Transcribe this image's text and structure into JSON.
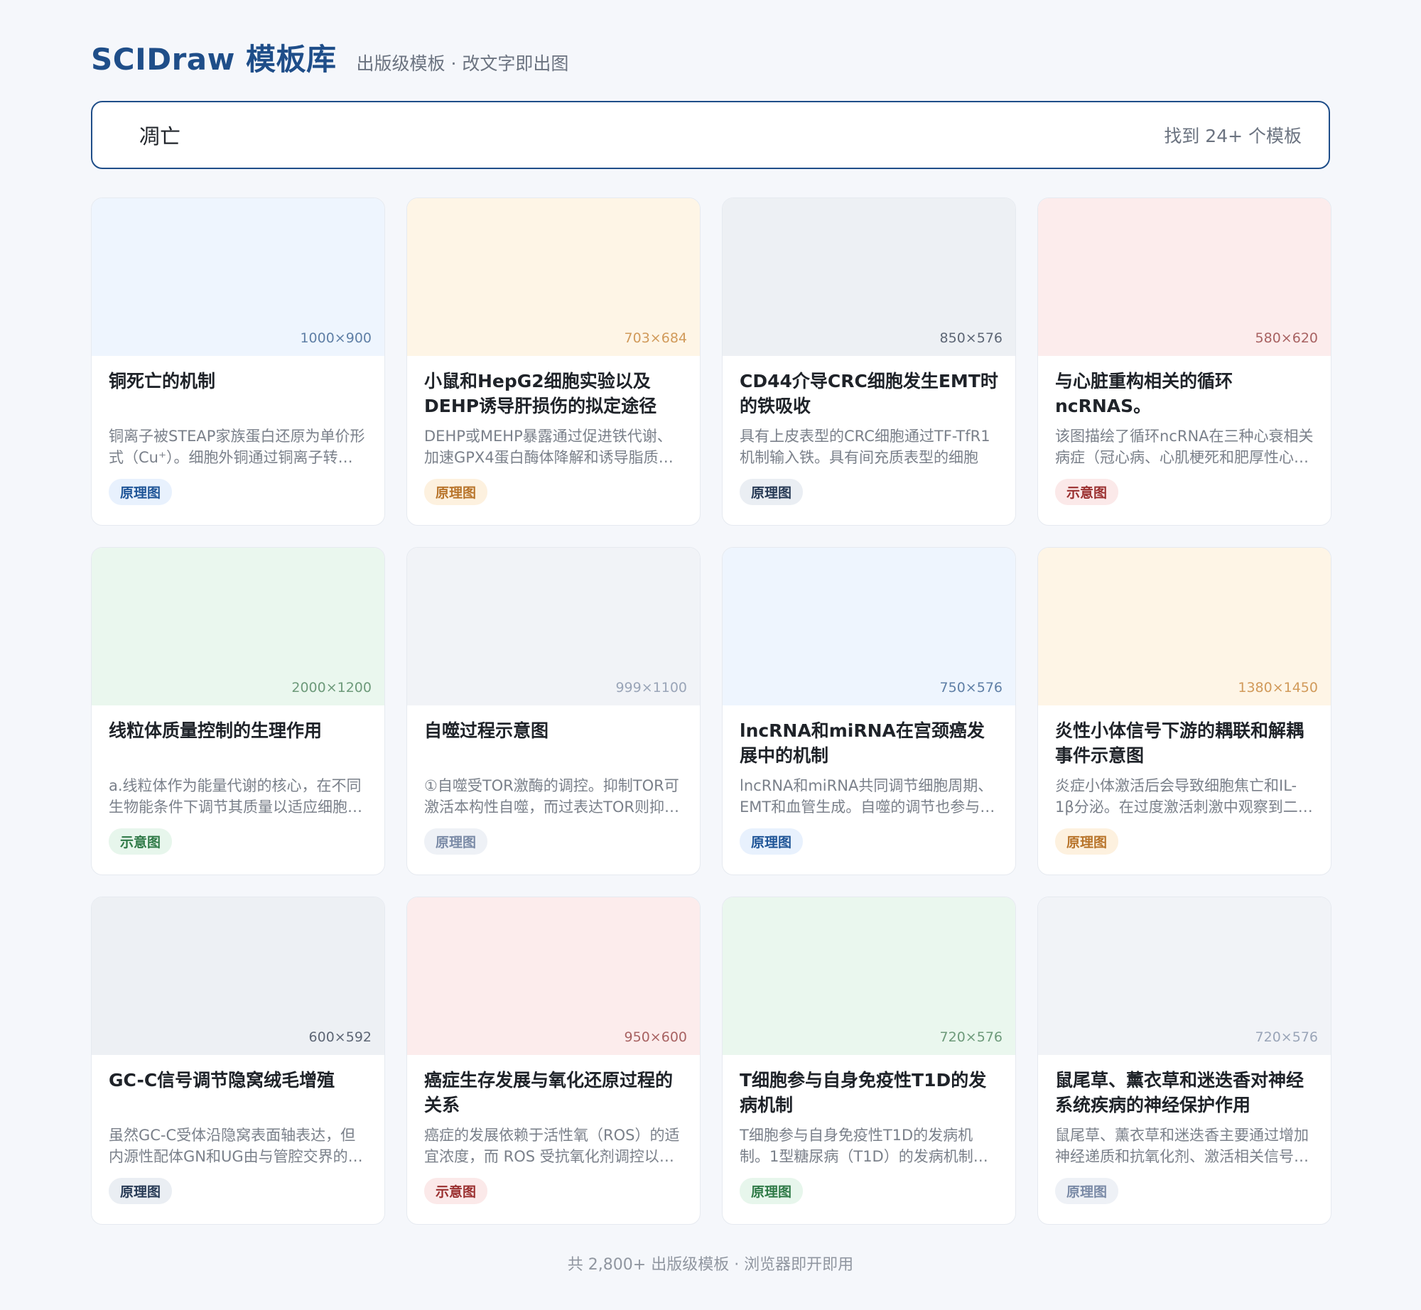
{
  "header": {
    "brand": "SCIDraw 模板库",
    "tagline": "出版级模板 · 改文字即出图"
  },
  "search": {
    "value": "凋亡",
    "result_count": "找到 24+ 个模板"
  },
  "cards": [
    {
      "dims": "1000×900",
      "title": "铜死亡的机制",
      "desc": "铜离子被STEAP家族蛋白还原为单价形式（Cu⁺）。细胞外铜通过铜离子转运蛋白进入细胞",
      "tag": "原理图",
      "thumb_bg": "#eef5fe",
      "dims_color": "#5f7fa6",
      "tag_bg": "#e8f1fd",
      "tag_color": "#1f5597"
    },
    {
      "dims": "703×684",
      "title": "小鼠和HepG2细胞实验以及DEHP诱导肝损伤的拟定途径",
      "desc": "DEHP或MEHP暴露通过促进铁代谢、加速GPX4蛋白酶体降解和诱导脂质过氧化",
      "tag": "原理图",
      "thumb_bg": "#fef5e6",
      "dims_color": "#d19a5a",
      "tag_bg": "#fdf1df",
      "tag_color": "#b8742a"
    },
    {
      "dims": "850×576",
      "title": "CD44介导CRC细胞发生EMT时的铁吸收",
      "desc": "具有上皮表型的CRC细胞通过TF-TfR1机制输入铁。具有间充质表型的细胞",
      "tag": "原理图",
      "thumb_bg": "#edf0f4",
      "dims_color": "#5d6675",
      "tag_bg": "#eaeef3",
      "tag_color": "#273a55"
    },
    {
      "dims": "580×620",
      "title": "与心脏重构相关的循环ncRNAS。",
      "desc": "该图描绘了循环ncRNA在三种心衰相关病症（冠心病、心肌梗死和肥厚性心肌病）中的作用",
      "tag": "示意图",
      "thumb_bg": "#fcecec",
      "dims_color": "#a86262",
      "tag_bg": "#fbe9e9",
      "tag_color": "#9a2f2f"
    },
    {
      "dims": "2000×1200",
      "title": "线粒体质量控制的生理作用",
      "desc": "a.线粒体作为能量代谢的核心，在不同生物能条件下调节其质量以适应细胞需求",
      "tag": "示意图",
      "thumb_bg": "#eaf7ee",
      "dims_color": "#6d9a7a",
      "tag_bg": "#e7f6ec",
      "tag_color": "#2f7a47"
    },
    {
      "dims": "999×1100",
      "title": "自噬过程示意图",
      "desc": "①自噬受TOR激酶的调控。抑制TOR可激活本构性自噬，而过表达TOR则抑制自噬",
      "tag": "原理图",
      "thumb_bg": "#f1f3f7",
      "dims_color": "#9aa5b8",
      "tag_bg": "#eef1f6",
      "tag_color": "#7a8aa6"
    },
    {
      "dims": "750×576",
      "title": "lncRNA和miRNA在宫颈癌发展中的机制",
      "desc": "lncRNA和miRNA共同调节细胞周期、EMT和血管生成。自噬的调节也参与其中",
      "tag": "原理图",
      "thumb_bg": "#eef5fe",
      "dims_color": "#5f7fa6",
      "tag_bg": "#e8f1fd",
      "tag_color": "#1f5597"
    },
    {
      "dims": "1380×1450",
      "title": "炎性小体信号下游的耦联和解耦事件示意图",
      "desc": "炎症小体激活后会导致细胞焦亡和IL-1β分泌。在过度激活刺激中观察到二者解耦",
      "tag": "原理图",
      "thumb_bg": "#fef5e6",
      "dims_color": "#d19a5a",
      "tag_bg": "#fdf1df",
      "tag_color": "#b8742a"
    },
    {
      "dims": "600×592",
      "title": "GC-C信号调节隐窝绒毛增殖",
      "desc": "虽然GC-C受体沿隐窝表面轴表达，但内源性配体GN和UG由与管腔交界的细胞分泌",
      "tag": "原理图",
      "thumb_bg": "#edf0f4",
      "dims_color": "#5d6675",
      "tag_bg": "#eaeef3",
      "tag_color": "#273a55"
    },
    {
      "dims": "950×600",
      "title": "癌症生存发展与氧化还原过程的关系",
      "desc": "癌症的发展依赖于活性氧（ROS）的适宜浓度，而 ROS 受抗氧化剂调控以维持平衡",
      "tag": "示意图",
      "thumb_bg": "#fcecec",
      "dims_color": "#a86262",
      "tag_bg": "#fbe9e9",
      "tag_color": "#9a2f2f"
    },
    {
      "dims": "720×576",
      "title": "T细胞参与自身免疫性T1D的发病机制",
      "desc": "T细胞参与自身免疫性T1D的发病机制。1型糖尿病（T1D）的发病机制涉及多种免疫细胞",
      "tag": "原理图",
      "thumb_bg": "#eaf7ee",
      "dims_color": "#6d9a7a",
      "tag_bg": "#e7f6ec",
      "tag_color": "#2f7a47"
    },
    {
      "dims": "720×576",
      "title": "鼠尾草、薰衣草和迷迭香对神经系统疾病的神经保护作用",
      "desc": "鼠尾草、薰衣草和迷迭香主要通过增加神经递质和抗氧化剂、激活相关信号通路发挥作用",
      "tag": "原理图",
      "thumb_bg": "#f1f3f7",
      "dims_color": "#9aa5b8",
      "tag_bg": "#eef1f6",
      "tag_color": "#7a8aa6"
    }
  ],
  "footer": {
    "text": "共 2,800+ 出版级模板 · 浏览器即开即用"
  }
}
